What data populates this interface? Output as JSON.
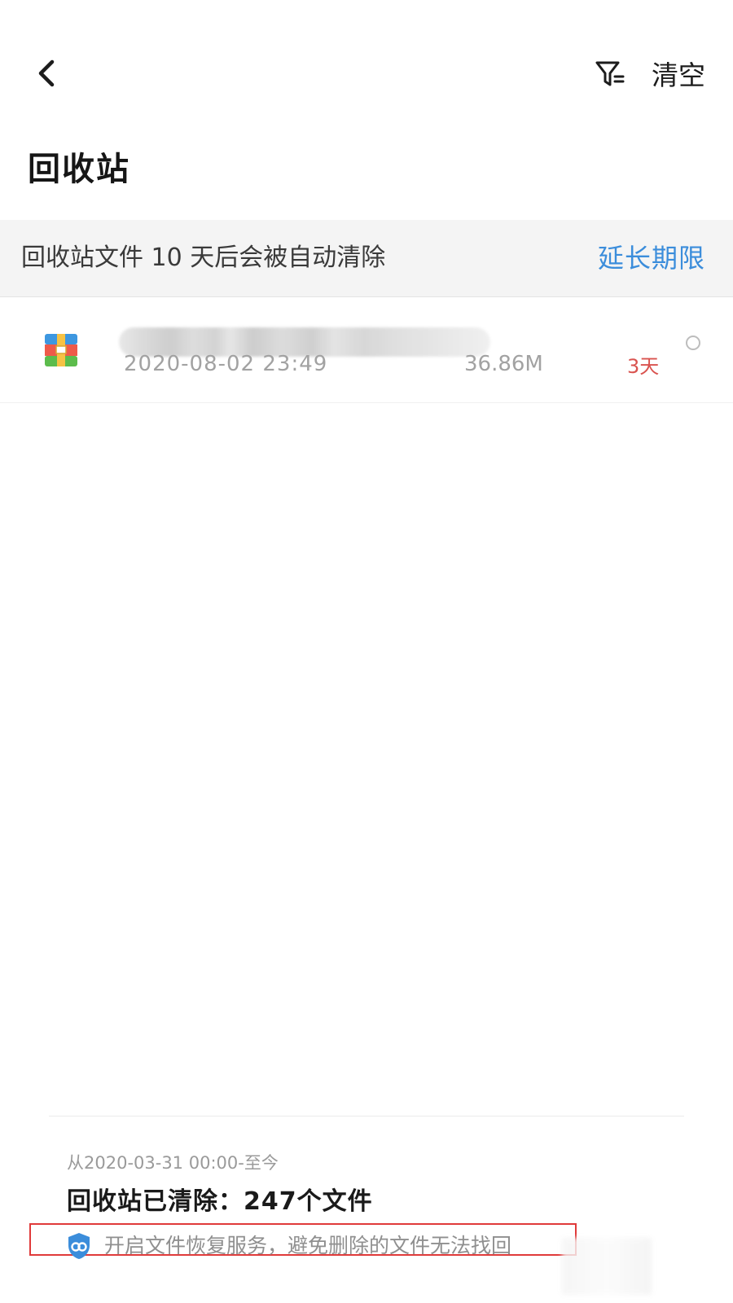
{
  "header": {
    "back_icon": "chevron-left-icon",
    "filter_icon": "filter-icon",
    "clear_label": "清空"
  },
  "page_title": "回收站",
  "notice": {
    "text": "回收站文件 10 天后会被自动清除",
    "action_label": "延长期限",
    "action_color": "#3b8ddb"
  },
  "files": [
    {
      "icon": "archive-file-icon",
      "name": "",
      "date": "2020-08-02 23:49",
      "size": "36.86M",
      "days_left": "3天",
      "days_color": "#d9534f",
      "selected": false
    }
  ],
  "stats": {
    "period": "从2020-03-31 00:00-至今",
    "label_prefix": "回收站已清除：",
    "count": "247",
    "label_suffix": "个文件"
  },
  "recovery": {
    "icon": "shield-cloud-icon",
    "text": "开启文件恢复服务，避免删除的文件无法找回",
    "highlight_color": "#e03a3a"
  }
}
